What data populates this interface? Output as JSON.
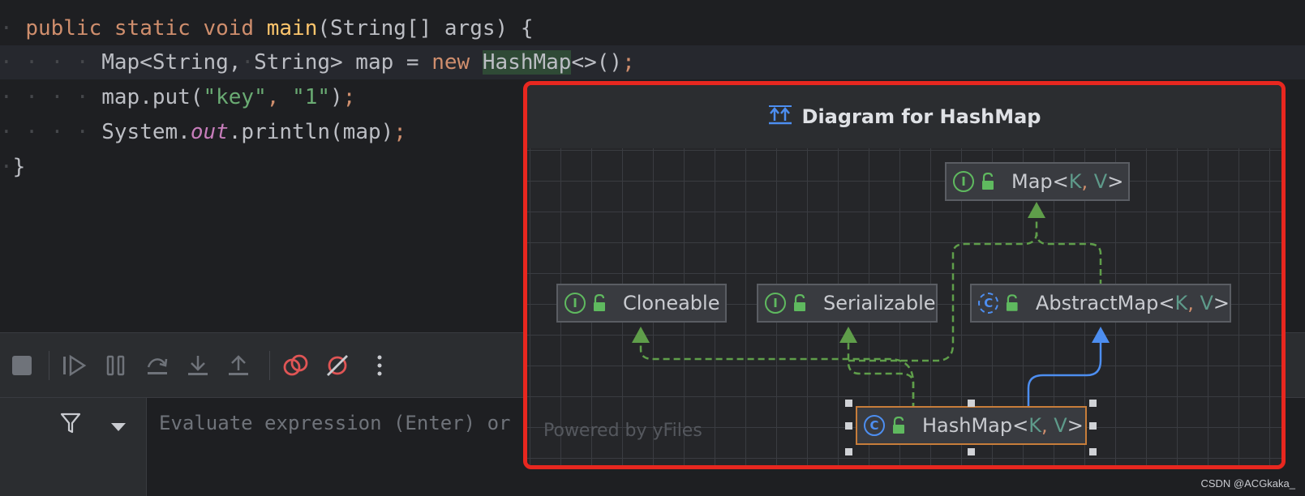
{
  "editor": {
    "lines": [
      {
        "t1": "public",
        "t2": "static",
        "t3": "void",
        "t4": "main",
        "t5": "(String[] args) {"
      },
      {
        "a": "Map<String,",
        "b": "String> map =",
        "c": "new",
        "d": "HashMap",
        "e": "<>()",
        "f": ";"
      },
      {
        "a": "map.put(",
        "b": "\"key\"",
        "c": ", ",
        "d": "\"1\"",
        "e": ")",
        "f": ";"
      },
      {
        "a": "System.",
        "b": "out",
        "c": ".println(map)",
        "f": ";"
      },
      {
        "a": "}"
      }
    ]
  },
  "toolbar": {
    "buttons": [
      "stop",
      "resume",
      "pause",
      "step-over",
      "step-into",
      "step-out",
      "view-breakpoints",
      "mute-breakpoints",
      "more"
    ]
  },
  "evaluate": {
    "placeholder": "Evaluate expression (Enter) or at"
  },
  "diagram": {
    "title": "Diagram for HashMap",
    "powered_by": "Powered by yFiles",
    "nodes": {
      "map": {
        "name": "Map<",
        "k": "K",
        "comma": ",",
        "v": "V",
        "close": ">",
        "kind": "I"
      },
      "cloneable": {
        "name": "Cloneable",
        "kind": "I"
      },
      "serializable": {
        "name": "Serializable",
        "kind": "I"
      },
      "abstractmap": {
        "name": "AbstractMap<",
        "k": "K",
        "comma": ",",
        "v": "V",
        "close": ">",
        "kind": "C"
      },
      "hashmap": {
        "name": "HashMap<",
        "k": "K",
        "comma": ",",
        "v": "V",
        "close": ">",
        "kind": "C"
      }
    },
    "colors": {
      "implements_edge": "#5f9e4a",
      "extends_edge": "#4d8ef0",
      "frame": "#e8271f",
      "selection": "#c77d3a"
    }
  },
  "watermark": "CSDN @ACGkaka_"
}
